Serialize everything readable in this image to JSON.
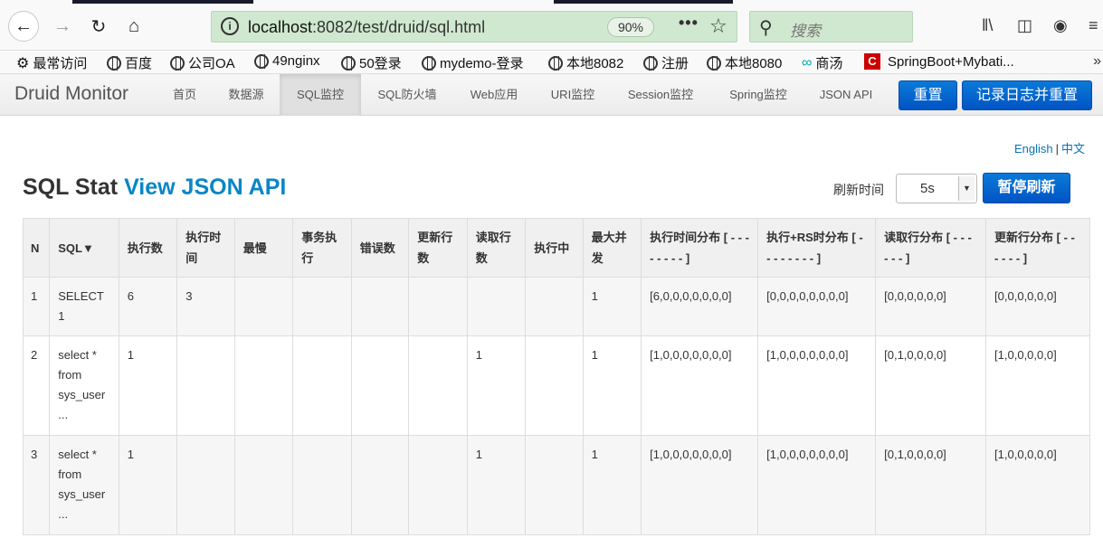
{
  "browser": {
    "url_host": "localhost",
    "url_path": ":8082/test/druid/sql.html",
    "zoom": "90%",
    "more": "•••",
    "search_placeholder": "搜索"
  },
  "bookmarks": [
    {
      "label": "最常访问",
      "icon": "gear-icon"
    },
    {
      "label": "百度",
      "icon": "globe-icon"
    },
    {
      "label": "公司OA",
      "icon": "globe-icon"
    },
    {
      "label": "49nginx",
      "icon": "globe-icon"
    },
    {
      "label": "50登录",
      "icon": "globe-icon"
    },
    {
      "label": "mydemo-登录",
      "icon": "globe-icon"
    },
    {
      "label": "本地8082",
      "icon": "globe-icon"
    },
    {
      "label": "注册",
      "icon": "globe-icon"
    },
    {
      "label": "本地8080",
      "icon": "globe-icon"
    },
    {
      "label": "商汤",
      "icon": "infinity-icon"
    },
    {
      "label": "SpringBoot+Mybati...",
      "icon": "csdn-icon"
    }
  ],
  "druid": {
    "brand": "Druid Monitor",
    "nav": [
      "首页",
      "数据源",
      "SQL监控",
      "SQL防火墙",
      "Web应用",
      "URI监控",
      "Session监控",
      "Spring监控",
      "JSON API"
    ],
    "reset": "重置",
    "log_reset": "记录日志并重置"
  },
  "lang": {
    "english": "English",
    "sep": "|",
    "chinese": "中文"
  },
  "page": {
    "title": "SQL Stat",
    "api_link": "View JSON API",
    "refresh_label": "刷新时间",
    "refresh_value": "5s",
    "pause": "暂停刷新"
  },
  "table": {
    "headers": [
      "N",
      "SQL▼",
      "执行数",
      "执行时间",
      "最慢",
      "事务执行",
      "错误数",
      "更新行数",
      "读取行数",
      "执行中",
      "最大并发",
      "执行时间分布 [ - - - - - - - - ]",
      "执行+RS时分布 [ - - - - - - - - ]",
      "读取行分布 [ - - - - - - ]",
      "更新行分布 [ - - - - - - ]"
    ],
    "rows": [
      [
        "1",
        "SELECT 1",
        "6",
        "3",
        "",
        "",
        "",
        "",
        "",
        "",
        "1",
        "[6,0,0,0,0,0,0,0]",
        "[0,0,0,0,0,0,0,0]",
        "[0,0,0,0,0,0]",
        "[0,0,0,0,0,0]"
      ],
      [
        "2",
        "select * from sys_user ...",
        "1",
        "",
        "",
        "",
        "",
        "",
        "1",
        "",
        "1",
        "[1,0,0,0,0,0,0,0]",
        "[1,0,0,0,0,0,0,0]",
        "[0,1,0,0,0,0]",
        "[1,0,0,0,0,0]"
      ],
      [
        "3",
        "select * from sys_user ...",
        "1",
        "",
        "",
        "",
        "",
        "",
        "1",
        "",
        "1",
        "[1,0,0,0,0,0,0,0]",
        "[1,0,0,0,0,0,0,0]",
        "[0,1,0,0,0,0]",
        "[1,0,0,0,0,0]"
      ]
    ]
  }
}
